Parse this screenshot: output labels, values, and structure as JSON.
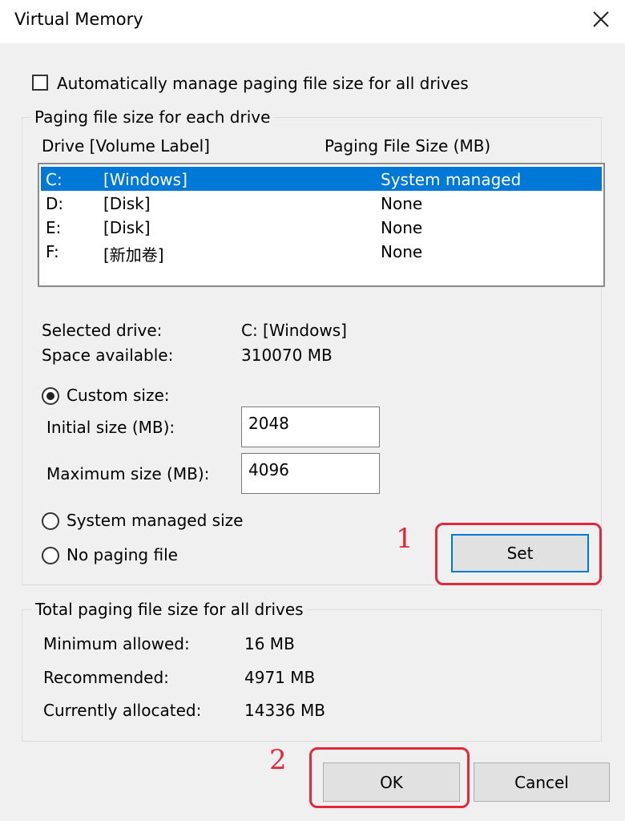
{
  "window": {
    "title": "Virtual Memory"
  },
  "auto_manage": {
    "label": "Automatically manage paging file size for all drives",
    "checked": false
  },
  "paging_group": {
    "legend": "Paging file size for each drive",
    "col_drive": "Drive  [Volume Label]",
    "col_size": "Paging File Size (MB)",
    "drives": [
      {
        "drive": "C:",
        "label": "[Windows]",
        "size": "System managed",
        "selected": true
      },
      {
        "drive": "D:",
        "label": "[Disk]",
        "size": "None",
        "selected": false
      },
      {
        "drive": "E:",
        "label": "[Disk]",
        "size": "None",
        "selected": false
      },
      {
        "drive": "F:",
        "label": "[新加卷]",
        "size": "None",
        "selected": false
      }
    ],
    "selected_drive_label": "Selected drive:",
    "selected_drive_value": "C:  [Windows]",
    "space_available_label": "Space available:",
    "space_available_value": "310070 MB",
    "custom_size_label": "Custom size:",
    "initial_size_label": "Initial size (MB):",
    "initial_size_value": "2048",
    "maximum_size_label": "Maximum size (MB):",
    "maximum_size_value": "4096",
    "system_managed_label": "System managed size",
    "no_paging_label": "No paging file",
    "set_button": "Set"
  },
  "total_group": {
    "legend": "Total paging file size for all drives",
    "minimum_label": "Minimum allowed:",
    "minimum_value": "16 MB",
    "recommended_label": "Recommended:",
    "recommended_value": "4971 MB",
    "allocated_label": "Currently allocated:",
    "allocated_value": "14336 MB"
  },
  "buttons": {
    "ok": "OK",
    "cancel": "Cancel"
  },
  "annotations": {
    "step1": "1",
    "step2": "2",
    "color": "#e0293a"
  },
  "colors": {
    "selection": "#0078d7",
    "focus": "#0078d7"
  },
  "icons": {
    "close": "close-icon",
    "radio_selected": "radio-selected-icon"
  }
}
